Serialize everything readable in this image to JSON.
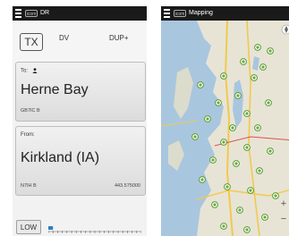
{
  "left_screen": {
    "status": {
      "title": "DR",
      "logo_text": "icom"
    },
    "mode": {
      "tx": "TX",
      "dv": "DV",
      "dup": "DUP+"
    },
    "to_card": {
      "label": "To:",
      "name": "Herne Bay",
      "callsign": "GB7IC B"
    },
    "from_card": {
      "label": "From:",
      "name": "Kirkland (IA)",
      "callsign": "N7IH  B",
      "frequency": "443.575000"
    },
    "power_button": "LOW",
    "signal_level": 0.05
  },
  "right_screen": {
    "status": {
      "title": "Mapping",
      "logo_text": "icom"
    },
    "zoom_in": "+",
    "zoom_out": "−"
  },
  "colors": {
    "status_bar": "#1a1a1a",
    "water": "#a9c6df",
    "land": "#e6e3d8",
    "marker": "#6aa83a",
    "road": "#f2c94c"
  },
  "icons": [
    "menu-icon",
    "person-icon",
    "compass-icon",
    "repeater-marker-icon"
  ]
}
